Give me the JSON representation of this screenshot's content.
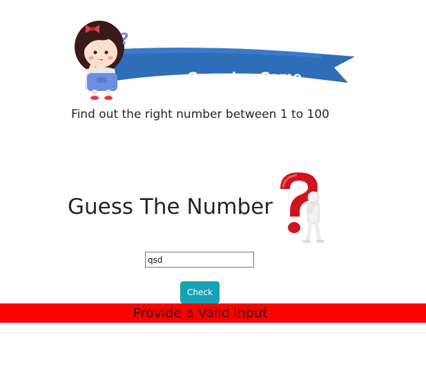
{
  "banner": {
    "title": "Guessing Game",
    "ribbon_color": "#2e6db8",
    "character_icon": "girl-thinking-icon"
  },
  "instructions": "Find out the right number between 1 to 100",
  "heading": "Guess The Number",
  "question_icon": "question-mark-figure-icon",
  "guess_input": {
    "value": "qsd",
    "placeholder": ""
  },
  "check_button": {
    "label": "Check",
    "color": "#17a2b8"
  },
  "alert": {
    "message": "Provide a Valid input",
    "background": "#ff0000"
  }
}
